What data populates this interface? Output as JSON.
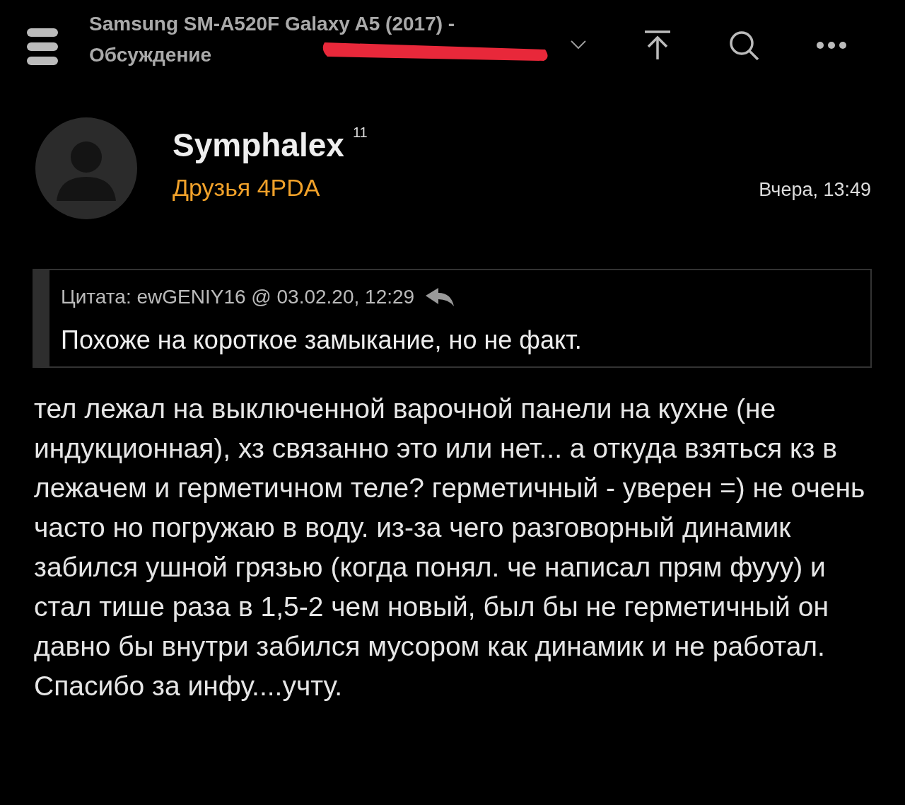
{
  "header": {
    "title": "Samsung SM-A520F Galaxy A5 (2017) -",
    "subtitle": "Обсуждение"
  },
  "post": {
    "author": "Symphalex",
    "reputation": "11",
    "group": "Друзья 4PDA",
    "time": "Вчера, 13:49",
    "quote": {
      "caption": "Цитата: ewGENIY16 @ 03.02.20, 12:29",
      "text": "Похоже на короткое замыкание, но не факт."
    },
    "body": "тел лежал на выключенной варочной панели на кухне (не индукционная), хз связанно это или нет... а откуда взяться кз в лежачем и герметичном теле? герметичный - уверен =) не очень часто но погружаю в воду. из-за чего разговорный динамик забился ушной грязью (когда понял. че написал прям фууу) и стал тише раза в 1,5-2 чем новый, был бы не герметичный он давно бы внутри забился мусором как динамик и не работал. Спасибо за инфу....учту."
  }
}
